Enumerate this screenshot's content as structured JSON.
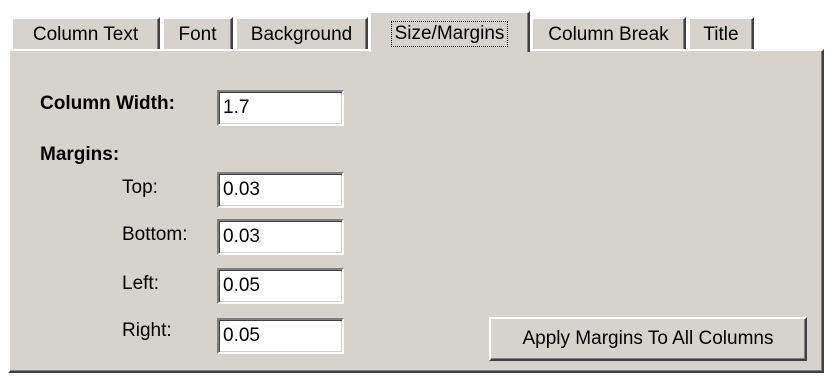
{
  "tabs": {
    "column_text": "Column Text",
    "font": "Font",
    "background": "Background",
    "size_margins": "Size/Margins",
    "column_break": "Column Break",
    "title": "Title"
  },
  "active_tab": "Size/Margins",
  "form": {
    "column_width_label": "Column Width:",
    "column_width_value": "1.7",
    "margins_label": "Margins:",
    "top_label": "Top:",
    "top_value": "0.03",
    "bottom_label": "Bottom:",
    "bottom_value": "0.03",
    "left_label": "Left:",
    "left_value": "0.05",
    "right_label": "Right:",
    "right_value": "0.05"
  },
  "buttons": {
    "apply_margins": "Apply Margins To All Columns"
  },
  "colors": {
    "face": "#d6d3ce",
    "highlight": "#ffffff",
    "shadow": "#808080",
    "dark_shadow": "#404040",
    "field": "#ffffff"
  }
}
